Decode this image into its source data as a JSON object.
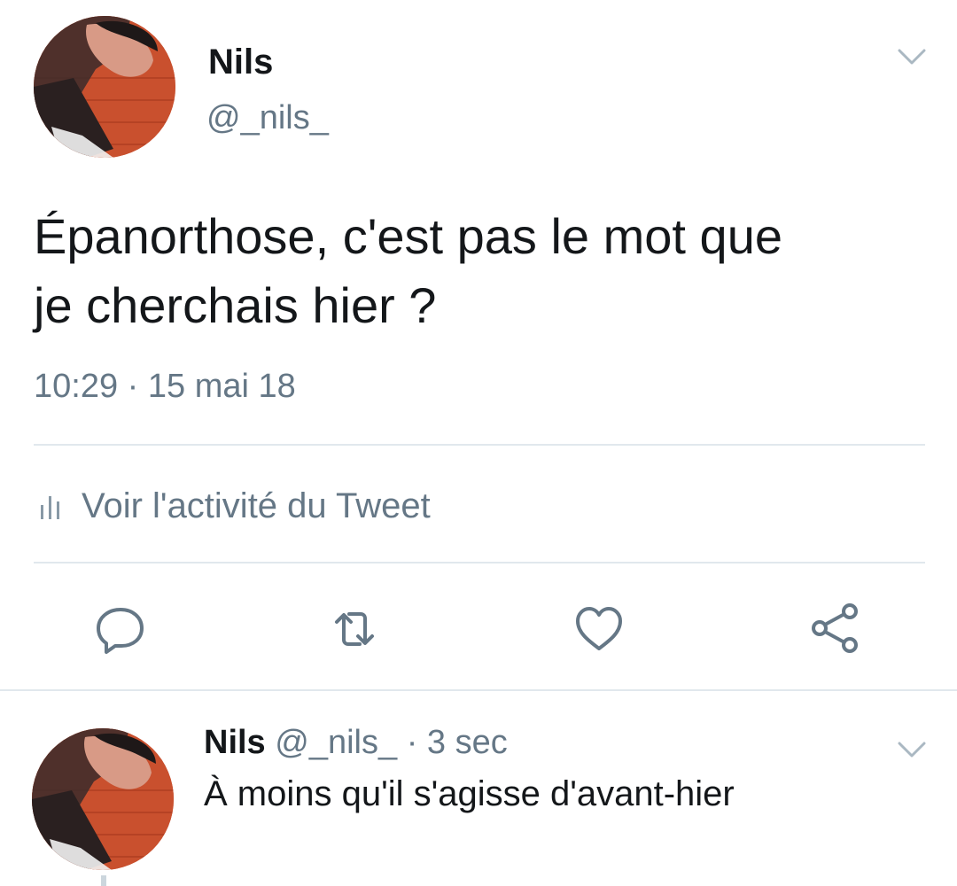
{
  "tweet": {
    "author": {
      "name": "Nils",
      "handle": "@_nils_"
    },
    "text_line1": "Épanorthose, c'est pas le mot que",
    "text_line2": "je cherchais hier ?",
    "time": "10:29",
    "separator": "·",
    "date": "15 mai 18",
    "activity_label": "Voir l'activité du Tweet",
    "actions": {
      "reply_icon": "reply-icon",
      "retweet_icon": "retweet-icon",
      "like_icon": "heart-icon",
      "share_icon": "share-icon"
    }
  },
  "reply": {
    "author": {
      "name": "Nils",
      "handle": "@_nils_"
    },
    "separator": "·",
    "time": "3 sec",
    "text": "À moins qu'il s'agisse d'avant-hier"
  },
  "colors": {
    "text": "#14171a",
    "secondary": "#657786",
    "divider": "#e1e8ed"
  }
}
